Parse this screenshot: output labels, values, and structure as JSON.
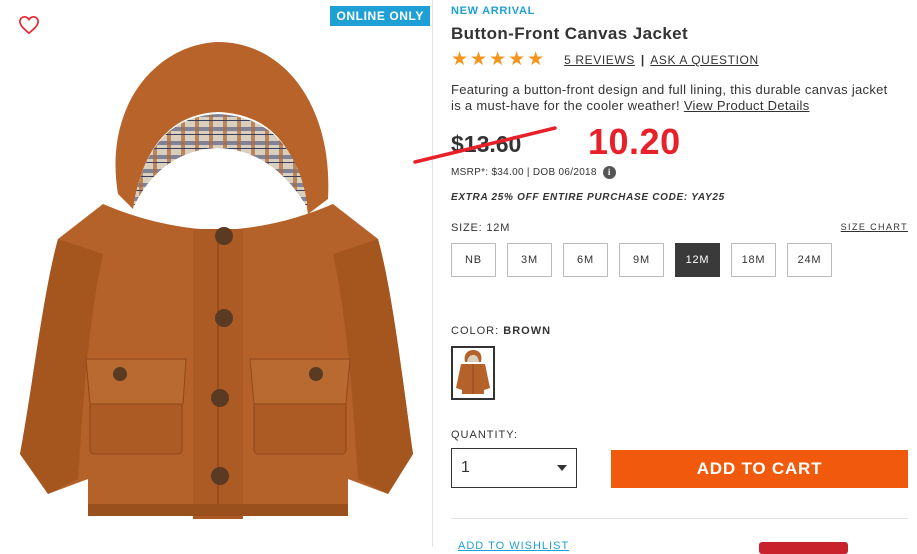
{
  "gallery": {
    "badge": "ONLINE ONLY",
    "heart_icon": "heart-outline-icon",
    "image": "brown hooded canvas jacket with plaid lining"
  },
  "product": {
    "tag": "NEW ARRIVAL",
    "title": "Button-Front Canvas Jacket",
    "rating": 5,
    "reviews_label": "5 REVIEWS",
    "ask_label": "ASK A QUESTION",
    "description": "Featuring a button-front design and full lining, this durable canvas jacket is a must-have for the cooler weather!",
    "details_link": "View Product Details",
    "old_price": "$13.60",
    "sale_price": "10.20",
    "msrp": "MSRP*: $34.00 | DOB 06/2018",
    "promo": "EXTRA 25% OFF ENTIRE PURCHASE CODE: YAY25"
  },
  "size": {
    "label": "SIZE:",
    "selected": "12M",
    "chart_link": "SIZE CHART",
    "options": [
      "NB",
      "3M",
      "6M",
      "9M",
      "12M",
      "18M",
      "24M"
    ]
  },
  "color": {
    "label": "COLOR:",
    "selected": "BROWN"
  },
  "quantity": {
    "label": "QUANTITY:",
    "value": "1"
  },
  "cart": {
    "button": "ADD TO CART"
  },
  "footer": {
    "wishlist": "ADD TO WISHLIST"
  },
  "colors": {
    "accent_blue": "#1fa0d4",
    "cta_orange": "#f15a0c",
    "sale_red": "#e8202a",
    "star_orange": "#f7941d",
    "jacket_brown": "#b5622a"
  }
}
